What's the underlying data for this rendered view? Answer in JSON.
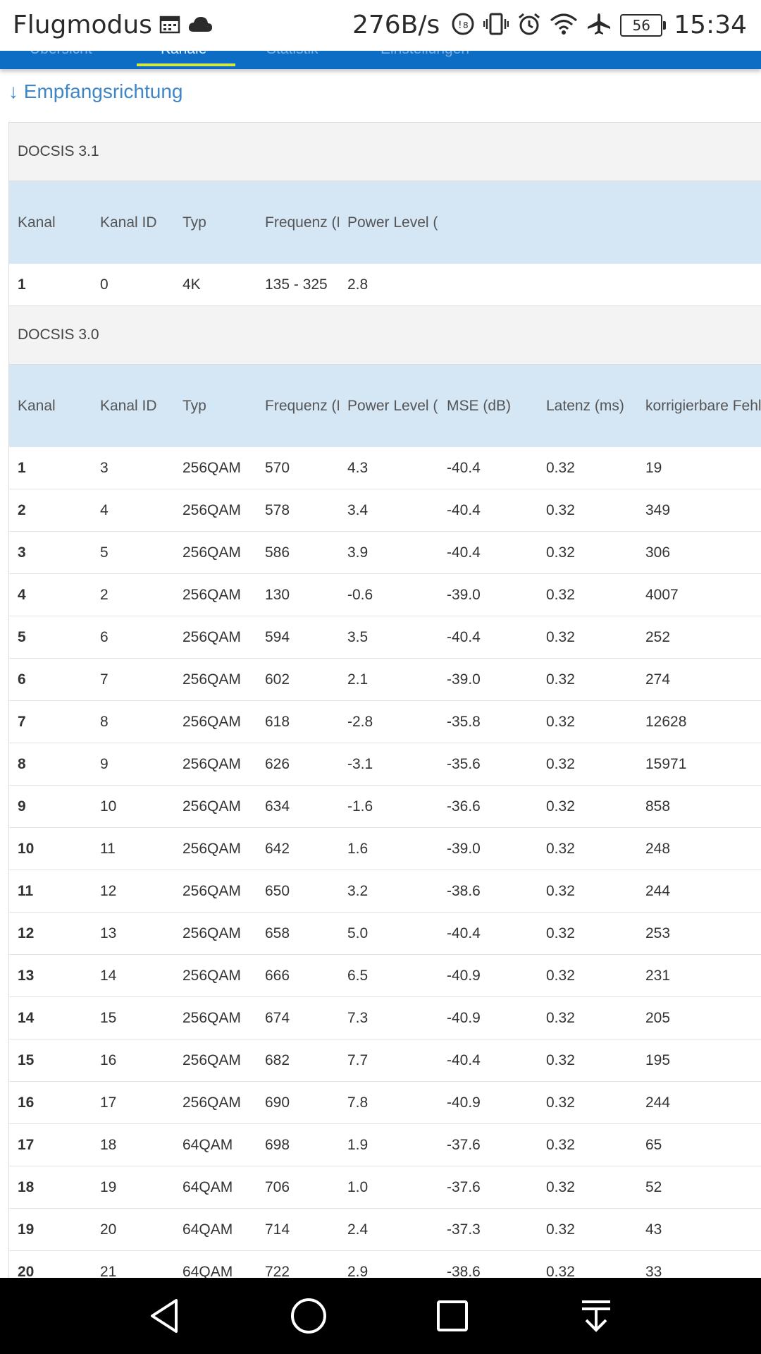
{
  "status_bar": {
    "title": "Flugmodus",
    "speed": "276B/s",
    "battery": "56",
    "time": "15:34",
    "icons": [
      "calendar-icon",
      "cloud-icon",
      "data-saver-icon",
      "vibrate-icon",
      "alarm-icon",
      "wifi-icon",
      "airplane-icon",
      "battery-icon"
    ]
  },
  "nav_tabs": [
    {
      "label": "Übersicht",
      "active": false
    },
    {
      "label": "Kanäle",
      "active": true
    },
    {
      "label": "Statistik",
      "active": false
    },
    {
      "label": "Einstellungen",
      "active": false
    }
  ],
  "colors": {
    "accent": "#0d6cc4",
    "tab_underline": "#d3e84a",
    "header_bg": "#d5e6f5",
    "section_bg": "#f3f3f3",
    "link": "#3f86c8"
  },
  "section": {
    "heading": "↓ Empfangsrichtung"
  },
  "docsis31": {
    "title": "DOCSIS 3.1",
    "columns": [
      "Kanal",
      "Kanal ID",
      "Typ",
      "Frequenz (MHz)",
      "Power Level (dBmV)"
    ],
    "rows": [
      [
        "1",
        "0",
        "4K",
        "135 - 325",
        "2.8"
      ]
    ]
  },
  "docsis30": {
    "title": "DOCSIS 3.0",
    "columns": [
      "Kanal",
      "Kanal ID",
      "Typ",
      "Frequenz (MHz)",
      "Power Level (dBmV)",
      "MSE (dB)",
      "Latenz (ms)",
      "korrigierbare Fehle"
    ],
    "rows": [
      [
        "1",
        "3",
        "256QAM",
        "570",
        "4.3",
        "-40.4",
        "0.32",
        "19"
      ],
      [
        "2",
        "4",
        "256QAM",
        "578",
        "3.4",
        "-40.4",
        "0.32",
        "349"
      ],
      [
        "3",
        "5",
        "256QAM",
        "586",
        "3.9",
        "-40.4",
        "0.32",
        "306"
      ],
      [
        "4",
        "2",
        "256QAM",
        "130",
        "-0.6",
        "-39.0",
        "0.32",
        "4007"
      ],
      [
        "5",
        "6",
        "256QAM",
        "594",
        "3.5",
        "-40.4",
        "0.32",
        "252"
      ],
      [
        "6",
        "7",
        "256QAM",
        "602",
        "2.1",
        "-39.0",
        "0.32",
        "274"
      ],
      [
        "7",
        "8",
        "256QAM",
        "618",
        "-2.8",
        "-35.8",
        "0.32",
        "12628"
      ],
      [
        "8",
        "9",
        "256QAM",
        "626",
        "-3.1",
        "-35.6",
        "0.32",
        "15971"
      ],
      [
        "9",
        "10",
        "256QAM",
        "634",
        "-1.6",
        "-36.6",
        "0.32",
        "858"
      ],
      [
        "10",
        "11",
        "256QAM",
        "642",
        "1.6",
        "-39.0",
        "0.32",
        "248"
      ],
      [
        "11",
        "12",
        "256QAM",
        "650",
        "3.2",
        "-38.6",
        "0.32",
        "244"
      ],
      [
        "12",
        "13",
        "256QAM",
        "658",
        "5.0",
        "-40.4",
        "0.32",
        "253"
      ],
      [
        "13",
        "14",
        "256QAM",
        "666",
        "6.5",
        "-40.9",
        "0.32",
        "231"
      ],
      [
        "14",
        "15",
        "256QAM",
        "674",
        "7.3",
        "-40.9",
        "0.32",
        "205"
      ],
      [
        "15",
        "16",
        "256QAM",
        "682",
        "7.7",
        "-40.4",
        "0.32",
        "195"
      ],
      [
        "16",
        "17",
        "256QAM",
        "690",
        "7.8",
        "-40.9",
        "0.32",
        "244"
      ],
      [
        "17",
        "18",
        "64QAM",
        "698",
        "1.9",
        "-37.6",
        "0.32",
        "65"
      ],
      [
        "18",
        "19",
        "64QAM",
        "706",
        "1.0",
        "-37.6",
        "0.32",
        "52"
      ],
      [
        "19",
        "20",
        "64QAM",
        "714",
        "2.4",
        "-37.3",
        "0.32",
        "43"
      ],
      [
        "20",
        "21",
        "64QAM",
        "722",
        "2.9",
        "-38.6",
        "0.32",
        "33"
      ]
    ]
  },
  "system_nav": {
    "buttons": [
      "back-icon",
      "home-icon",
      "recents-icon",
      "notification-pulldown-icon"
    ]
  }
}
